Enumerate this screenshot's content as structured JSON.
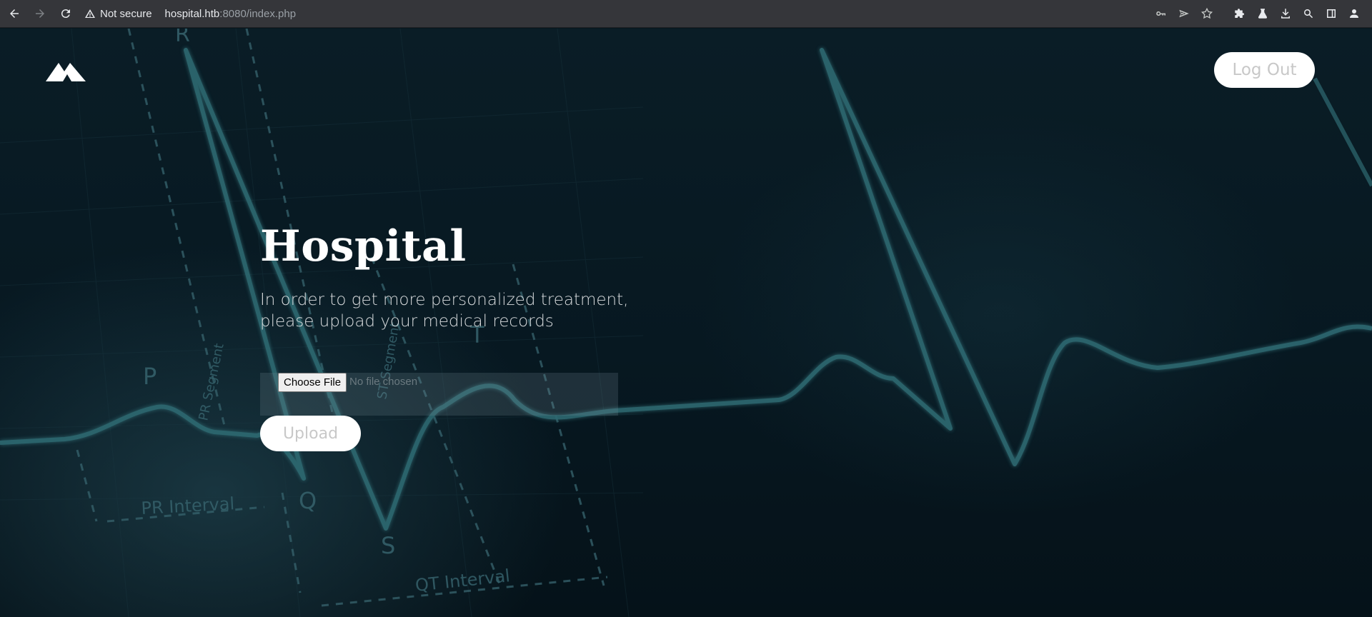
{
  "browser": {
    "security_label": "Not secure",
    "url_host": "hospital.htb",
    "url_path": ":8080/index.php",
    "icons": [
      "back-icon",
      "forward-icon",
      "reload-icon",
      "warning-icon",
      "key-icon",
      "send-icon",
      "star-icon",
      "puzzle-icon",
      "flask-icon",
      "download-icon",
      "search-icon",
      "sidepanel-icon",
      "profile-icon"
    ]
  },
  "header": {
    "logout_label": "Log Out"
  },
  "hero": {
    "title": "Hospital",
    "subtitle": "In order to get more personalized treatment, please upload your medical records"
  },
  "upload_form": {
    "choose_file_label": "Choose File",
    "no_file_text": "No file chosen",
    "upload_label": "Upload"
  },
  "background_labels": {
    "r": "R",
    "p": "P",
    "t": "T",
    "q": "Q",
    "s": "S",
    "pr_segment": "PR Segment",
    "st_segment": "ST Segment",
    "pr_interval": "PR Interval",
    "qt_interval": "QT Interval"
  },
  "colors": {
    "page_bg": "#06171f",
    "ecg_line": "#2f6a72",
    "chrome_bg": "#35363a",
    "button_bg": "#ffffff",
    "button_text": "#c8c8c8"
  }
}
